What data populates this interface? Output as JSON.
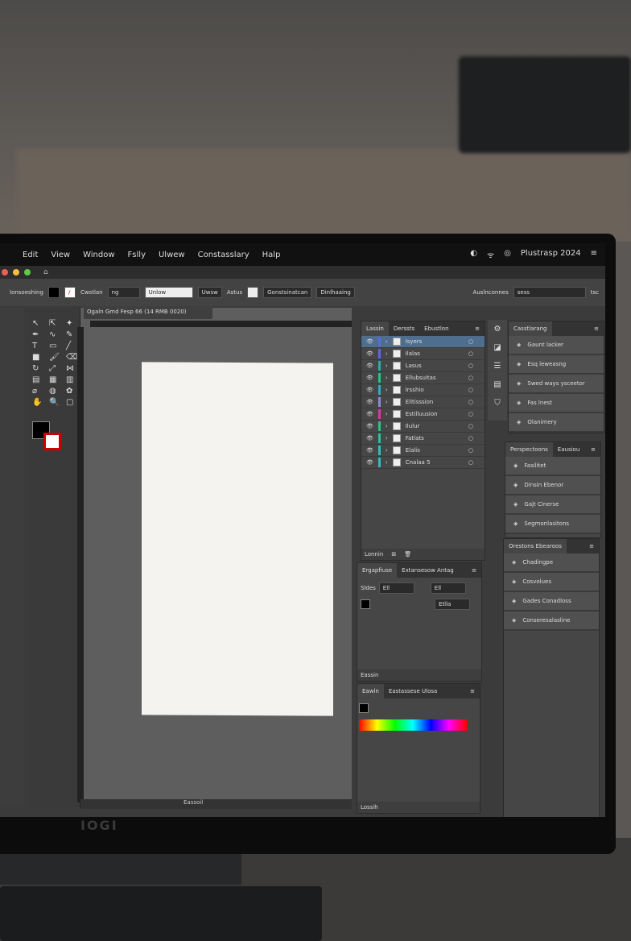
{
  "menubar": {
    "items": [
      "Edit",
      "View",
      "Window",
      "Fslly",
      "Ulwew",
      "Constasslary",
      "Halp"
    ],
    "app_label": "Plustrasp 2024"
  },
  "control_bar": {
    "label": "Ionsoeshing",
    "stroke_label": "Cwstlan",
    "stroke_value": "ng",
    "brush": "Unlow",
    "style": "Uwsw",
    "opacity_label": "Astus",
    "btn1": "Gonstsinatcan",
    "btn2": "Dinlhaaing",
    "search": "Auslnconnes",
    "search_box": "sess",
    "zoom_tail": "tsc"
  },
  "document": {
    "tab": "Ogaln Gmd Fesp 66 (14 RMB 0020)",
    "status": "Eassoil"
  },
  "layers": {
    "tabs": [
      "Lassin",
      "Derssts",
      "Ebustlon"
    ],
    "items": [
      {
        "name": "lsyers",
        "color": "#5a6bd8"
      },
      {
        "name": "Ilalas",
        "color": "#5a6bd8"
      },
      {
        "name": "Lasus",
        "color": "#3aa6a6"
      },
      {
        "name": "Ellubsuitas",
        "color": "#2fbf8a"
      },
      {
        "name": "Irsshio",
        "color": "#3aa6c6"
      },
      {
        "name": "Elitisssion",
        "color": "#8a8ad8"
      },
      {
        "name": "Estilluusion",
        "color": "#d23aa6"
      },
      {
        "name": "Ilulur",
        "color": "#2fbf8a"
      },
      {
        "name": "Fatlats",
        "color": "#2fbf9a"
      },
      {
        "name": "Elalis",
        "color": "#3ab6c6"
      },
      {
        "name": "Cnalaa 5",
        "color": "#3ab6c6"
      }
    ],
    "footer": "Lonnin"
  },
  "properties": {
    "tabs": [
      "Ergapfiuse",
      "Extansesow Antag"
    ],
    "field1_label": "Sldes",
    "field1": "Ell",
    "field2": "Ell",
    "field3": "Etlla",
    "footer": "Eassin"
  },
  "color": {
    "tabs": [
      "Eawln",
      "Eastassese Ulosa"
    ],
    "footer": "Lossih"
  },
  "right": {
    "group1": {
      "title": "Casstlarang",
      "items": [
        "Gaunt lacker",
        "Esq leweasng",
        "Swed ways ysceetor",
        "Fas lnest",
        "Olanimery"
      ]
    },
    "group2": {
      "tabs": [
        "Perspectoons",
        "Eausiou"
      ],
      "items": [
        "Fasilitet",
        "Dinsin Ebenor",
        "Gajt Cinerse",
        "Segmonlasitons"
      ]
    },
    "group3": {
      "title": "Orestons Ebearoos",
      "items": [
        "Chadingpe",
        "Cosvolues",
        "Gades Conadloss",
        "Conseresalasline"
      ]
    }
  },
  "bezel_logo": "IOGI"
}
